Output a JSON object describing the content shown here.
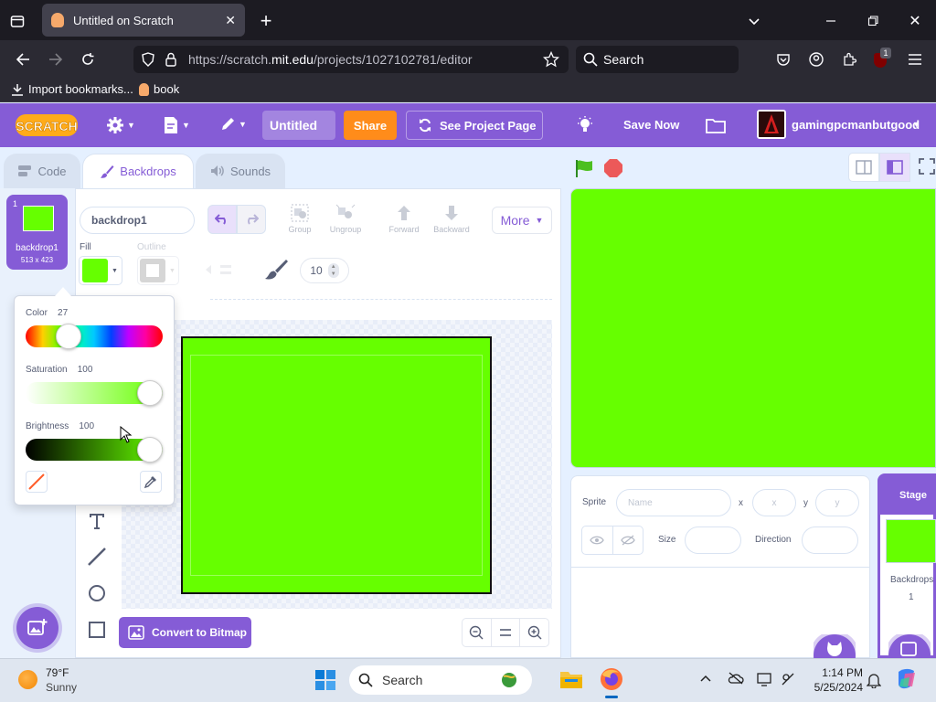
{
  "browser": {
    "tab_title": "Untitled on Scratch",
    "url_prefix": "https://scratch.",
    "url_domain": "mit.edu",
    "url_path": "/projects/1027102781/editor",
    "search_placeholder": "Search",
    "bookmarks": [
      "Import bookmarks...",
      "book"
    ],
    "extension_badge": "1"
  },
  "menubar": {
    "logo": "Scratch",
    "project_title": "Untitled",
    "share_label": "Share",
    "see_project_label": "See Project Page",
    "save_label": "Save Now",
    "username": "gamingpcmanbutgood"
  },
  "tabs": {
    "code": "Code",
    "backdrops": "Backdrops",
    "sounds": "Sounds"
  },
  "costume": {
    "index": "1",
    "name": "backdrop1",
    "size": "513 x 423"
  },
  "paint": {
    "name_value": "backdrop1",
    "group": "Group",
    "ungroup": "Ungroup",
    "forward": "Forward",
    "backward": "Backward",
    "more": "More",
    "fill_label": "Fill",
    "outline_label": "Outline",
    "brush_size": "10",
    "convert_label": "Convert to Bitmap",
    "fill_color": "#66ff00"
  },
  "color_picker": {
    "color_label": "Color",
    "color_value": "27",
    "saturation_label": "Saturation",
    "saturation_value": "100",
    "brightness_label": "Brightness",
    "brightness_value": "100",
    "color_fraction": 0.27,
    "saturation_fraction": 1.0,
    "brightness_fraction": 1.0
  },
  "sprite_info": {
    "sprite_label": "Sprite",
    "name_placeholder": "Name",
    "x_label": "x",
    "x_placeholder": "x",
    "y_label": "y",
    "y_placeholder": "y",
    "size_label": "Size",
    "direction_label": "Direction"
  },
  "stage_panel": {
    "title": "Stage",
    "backdrops_label": "Backdrops",
    "backdrops_count": "1"
  },
  "taskbar": {
    "temp": "79°F",
    "weather": "Sunny",
    "search": "Search",
    "time": "1:14 PM",
    "date": "5/25/2024"
  },
  "colors": {
    "scratch_purple": "#855cd6",
    "share_orange": "#ff8c1a",
    "stage_green": "#66ff00"
  }
}
